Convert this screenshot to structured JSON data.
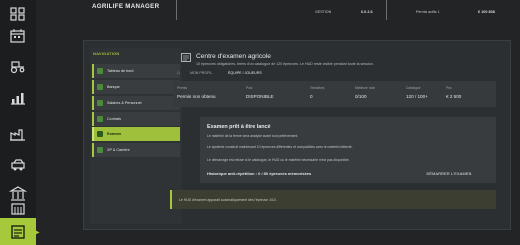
{
  "header": {
    "app_title": "AGRILIFE MANAGER",
    "stats": [
      {
        "label": "GESTION",
        "value": "6.0.2.6"
      },
      {
        "label": "Permis actifs 1",
        "value": "€ 100 808"
      }
    ]
  },
  "rail": {
    "icons": [
      "grid-icon",
      "calendar-icon",
      "tractor-icon",
      "chart-icon",
      "factory-icon",
      "vehicle-icon",
      "building-icon",
      "building-icon-2",
      "warehouse-icon"
    ],
    "active_icon": "exam-icon",
    "accent": "#a6c93b"
  },
  "nav": {
    "header": "NAVIGATION",
    "items": [
      {
        "label": "Tableau de bord",
        "active": false
      },
      {
        "label": "Banque",
        "active": false
      },
      {
        "label": "Salaires & Personnel",
        "active": false
      },
      {
        "label": "Contrats",
        "active": false
      },
      {
        "label": "Examen",
        "active": true
      },
      {
        "label": "XP & Carrière",
        "active": false
      }
    ]
  },
  "content": {
    "title": "Centre d'examen agricole",
    "subtitle": "10 épreuves obligatoires, tirées d'un catalogue de 120 épreuves. Le HUD reste visible pendant toute la session.",
    "tabs": {
      "profile": "MON PROFIL",
      "team": "ÉQUIPE / JOUEURS"
    },
    "stats": [
      {
        "label": "Permis",
        "value": "Permis non obtenu"
      },
      {
        "label": "Pool",
        "value": "DISPONIBLE"
      },
      {
        "label": "Tentatives",
        "value": "0"
      },
      {
        "label": "Meilleure note",
        "value": "0/100"
      },
      {
        "label": "Catalogue",
        "value": "120 / 100+"
      },
      {
        "label": "Prix",
        "value": "€ 2 500"
      }
    ],
    "exam": {
      "title": "Examen prêt à être lancé",
      "lines": [
        "Le matériel de la ferme sera analysé avant tout prélèvement.",
        "Le système construit maintenant 10 épreuves différentes et compatibles avec le matériel détecté.",
        "Le démarrage est refusé si le catalogue, le HUD ou le matériel nécessaire n'est pas disponible."
      ],
      "history": "Historique anti-répétition : 0 / 80 épreuves mémorisées",
      "start_button": "DÉMARRER L'EXAMEN"
    },
    "note": "Le HUD d'examen apparaît automatiquement dès l'épreuve 1/10."
  }
}
